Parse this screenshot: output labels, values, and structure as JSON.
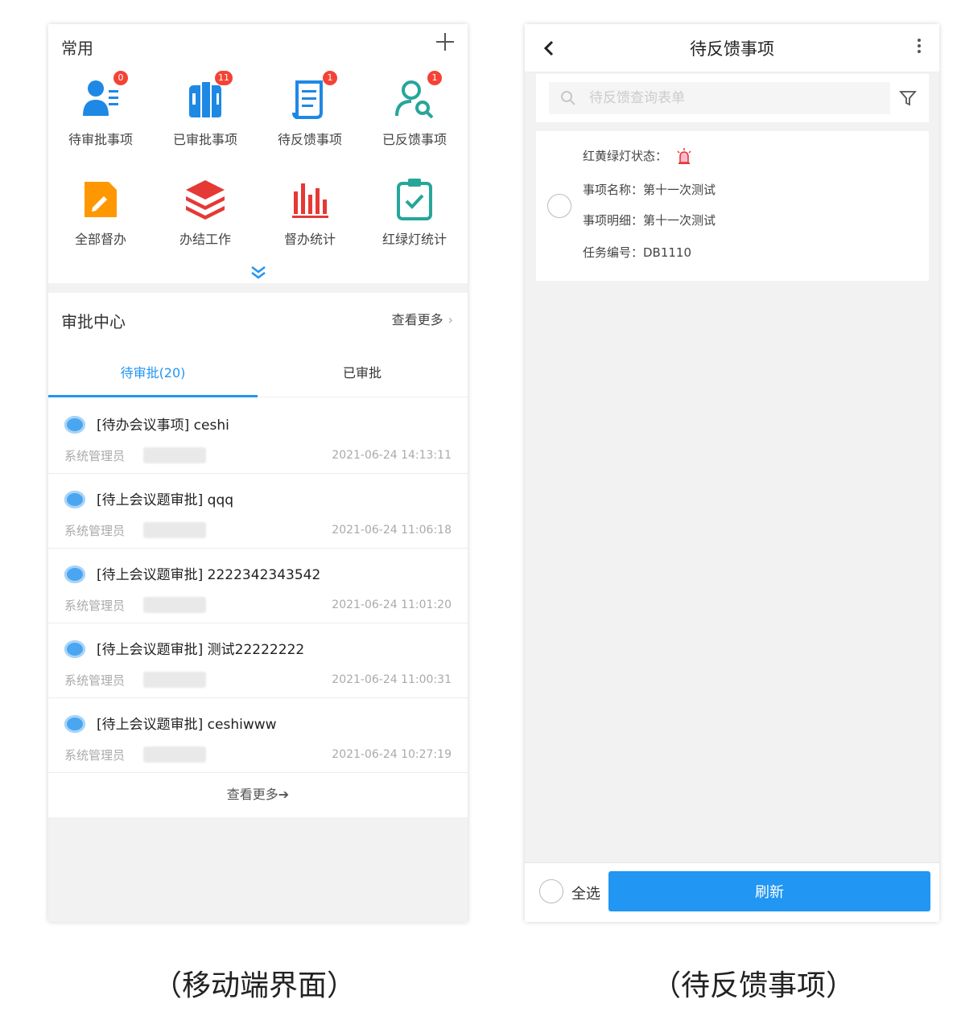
{
  "left": {
    "common": {
      "title": "常用",
      "items": [
        {
          "label": "待审批事项",
          "badge": "0",
          "icon": "user-list-icon"
        },
        {
          "label": "已审批事项",
          "badge": "11",
          "icon": "books-icon"
        },
        {
          "label": "待反馈事项",
          "badge": "1",
          "icon": "document-icon"
        },
        {
          "label": "已反馈事项",
          "badge": "1",
          "icon": "user-search-icon"
        },
        {
          "label": "全部督办",
          "icon": "edit-doc-icon"
        },
        {
          "label": "办结工作",
          "icon": "layers-icon"
        },
        {
          "label": "督办统计",
          "icon": "bar-chart-icon"
        },
        {
          "label": "红绿灯统计",
          "icon": "clipboard-check-icon"
        }
      ]
    },
    "approval": {
      "title": "审批中心",
      "more": "查看更多",
      "tabs": [
        "待审批(20)",
        "已审批"
      ],
      "list": [
        {
          "title": "[待办会议事项] ceshi",
          "sub": "系统管理员",
          "time": "2021-06-24 14:13:11"
        },
        {
          "title": "[待上会议题审批] qqq",
          "sub": "系统管理员",
          "time": "2021-06-24 11:06:18"
        },
        {
          "title": "[待上会议题审批] 2222342343542",
          "sub": "系统管理员",
          "time": "2021-06-24 11:01:20"
        },
        {
          "title": "[待上会议题审批] 测试22222222",
          "sub": "系统管理员",
          "time": "2021-06-24 11:00:31"
        },
        {
          "title": "[待上会议题审批] ceshiwww",
          "sub": "系统管理员",
          "time": "2021-06-24 10:27:19"
        }
      ],
      "view_more_bottom": "查看更多➔"
    },
    "caption": "（移动端界面）"
  },
  "right": {
    "title": "待反馈事项",
    "search_placeholder": "待反馈查询表单",
    "record": {
      "light_label": "红黄绿灯状态：",
      "name_label": "事项名称：第十一次测试",
      "detail_label": "事项明细：第十一次测试",
      "code_label": "任务编号：DB1110"
    },
    "select_all": "全选",
    "refresh": "刷新",
    "caption": "（待反馈事项）"
  },
  "colors": {
    "primary": "#2196f3",
    "badge": "#f44336",
    "icon_blue": "#1e88e5",
    "icon_orange": "#ff9800",
    "icon_red": "#e53935",
    "icon_teal": "#26a69a"
  }
}
